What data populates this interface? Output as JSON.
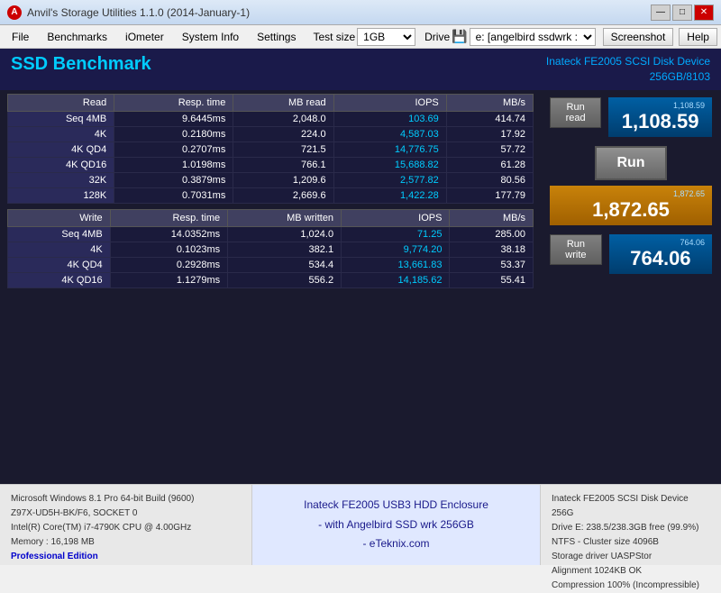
{
  "titlebar": {
    "title": "Anvil's Storage Utilities 1.1.0 (2014-January-1)",
    "icon_label": "A",
    "min_btn": "—",
    "max_btn": "□",
    "close_btn": "✕"
  },
  "menubar": {
    "file": "File",
    "benchmarks": "Benchmarks",
    "iometer": "iOmeter",
    "system_info": "System Info",
    "settings": "Settings",
    "test_size_label": "Test size",
    "test_size_value": "1GB",
    "drive_label": "Drive",
    "drive_icon": "💾",
    "drive_value": "e: [angelbird ssdwrk :",
    "screenshot_btn": "Screenshot",
    "help_btn": "Help"
  },
  "header": {
    "title": "SSD Benchmark",
    "device_line1": "Inateck FE2005 SCSI Disk Device",
    "device_line2": "256GB/8103"
  },
  "read_table": {
    "columns": [
      "Read",
      "Resp. time",
      "MB read",
      "IOPS",
      "MB/s"
    ],
    "rows": [
      {
        "name": "Seq 4MB",
        "resp": "9.6445ms",
        "mb": "2,048.0",
        "iops": "103.69",
        "mbs": "414.74"
      },
      {
        "name": "4K",
        "resp": "0.2180ms",
        "mb": "224.0",
        "iops": "4,587.03",
        "mbs": "17.92"
      },
      {
        "name": "4K QD4",
        "resp": "0.2707ms",
        "mb": "721.5",
        "iops": "14,776.75",
        "mbs": "57.72"
      },
      {
        "name": "4K QD16",
        "resp": "1.0198ms",
        "mb": "766.1",
        "iops": "15,688.82",
        "mbs": "61.28"
      },
      {
        "name": "32K",
        "resp": "0.3879ms",
        "mb": "1,209.6",
        "iops": "2,577.82",
        "mbs": "80.56"
      },
      {
        "name": "128K",
        "resp": "0.7031ms",
        "mb": "2,669.6",
        "iops": "1,422.28",
        "mbs": "177.79"
      }
    ]
  },
  "write_table": {
    "columns": [
      "Write",
      "Resp. time",
      "MB written",
      "IOPS",
      "MB/s"
    ],
    "rows": [
      {
        "name": "Seq 4MB",
        "resp": "14.0352ms",
        "mb": "1,024.0",
        "iops": "71.25",
        "mbs": "285.00"
      },
      {
        "name": "4K",
        "resp": "0.1023ms",
        "mb": "382.1",
        "iops": "9,774.20",
        "mbs": "38.18"
      },
      {
        "name": "4K QD4",
        "resp": "0.2928ms",
        "mb": "534.4",
        "iops": "13,661.83",
        "mbs": "53.37"
      },
      {
        "name": "4K QD16",
        "resp": "1.1279ms",
        "mb": "556.2",
        "iops": "14,185.62",
        "mbs": "55.41"
      }
    ]
  },
  "right_panel": {
    "run_read_label": "Run read",
    "run_btn_label": "Run",
    "run_write_label": "Run write",
    "read_score_small": "1,108.59",
    "read_score_big": "1,108.59",
    "total_score_small": "1,872.65",
    "total_score_big": "1,872.65",
    "write_score_small": "764.06",
    "write_score_big": "764.06"
  },
  "footer": {
    "left": {
      "os": "Microsoft Windows 8.1 Pro 64-bit Build (9600)",
      "motherboard": "Z97X-UD5H-BK/F6, SOCKET 0",
      "cpu": "Intel(R) Core(TM) i7-4790K CPU @ 4.00GHz",
      "memory": "Memory : 16,198 MB",
      "edition": "Professional Edition"
    },
    "center": {
      "line1": "Inateck FE2005 USB3 HDD Enclosure",
      "line2": "- with Angelbird SSD wrk 256GB",
      "line3": "- eTeknix.com"
    },
    "right": {
      "line1": "Inateck FE2005 SCSI Disk Device 256G",
      "line2": "Drive E: 238.5/238.3GB free (99.9%)",
      "line3": "NTFS - Cluster size 4096B",
      "line4": "Storage driver  UASPStor",
      "line5": "Alignment 1024KB OK",
      "line6": "Compression 100% (Incompressible)"
    }
  }
}
